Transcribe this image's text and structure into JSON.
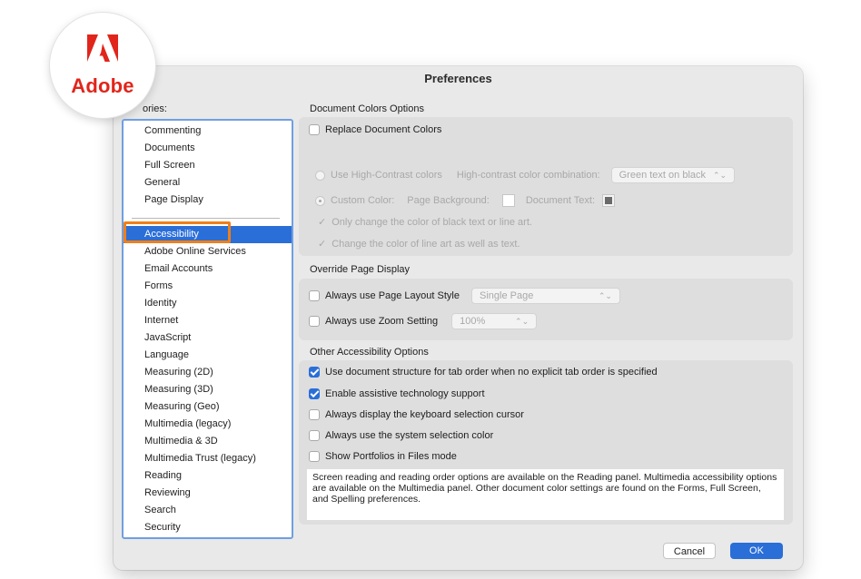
{
  "window": {
    "title": "Preferences"
  },
  "logo": {
    "text": "Adobe",
    "color": "#e1251b"
  },
  "categories": {
    "label": "ories:",
    "top_items": [
      "Commenting",
      "Documents",
      "Full Screen",
      "General",
      "Page Display"
    ],
    "items": [
      "Accessibility",
      "Adobe Online Services",
      "Email Accounts",
      "Forms",
      "Identity",
      "Internet",
      "JavaScript",
      "Language",
      "Measuring (2D)",
      "Measuring (3D)",
      "Measuring (Geo)",
      "Multimedia (legacy)",
      "Multimedia & 3D",
      "Multimedia Trust (legacy)",
      "Reading",
      "Reviewing",
      "Search",
      "Security"
    ],
    "selected": "Accessibility"
  },
  "document_colors": {
    "title": "Document Colors Options",
    "replace_label": "Replace Document Colors",
    "high_contrast_label": "Use High-Contrast colors",
    "combo_label": "High-contrast color combination:",
    "combo_value": "Green text on black",
    "custom_label": "Custom Color:",
    "page_bg_label": "Page Background:",
    "doc_text_label": "Document Text:",
    "only_black_label": "Only change the color of black text or line art.",
    "line_art_label": "Change the color of line art as well as text."
  },
  "override_display": {
    "title": "Override Page Display",
    "layout_label": "Always use Page Layout Style",
    "layout_value": "Single Page",
    "zoom_label": "Always use Zoom Setting",
    "zoom_value": "100%"
  },
  "other_accessibility": {
    "title": "Other Accessibility Options",
    "opt1": "Use document structure for tab order when no explicit tab order is specified",
    "opt2": "Enable assistive technology support",
    "opt3": "Always display the keyboard selection cursor",
    "opt4": "Always use the system selection color",
    "opt5": "Show Portfolios in Files mode",
    "info": "Screen reading and reading order options are available on the Reading panel. Multimedia accessibility options are available on the Multimedia panel. Other document color settings are found on the Forms, Full Screen, and Spelling preferences."
  },
  "buttons": {
    "cancel": "Cancel",
    "ok": "OK"
  },
  "colors": {
    "accent": "#2a6ed8",
    "highlight_box": "#f07f19",
    "swatch_text": "#6a6a6a"
  }
}
